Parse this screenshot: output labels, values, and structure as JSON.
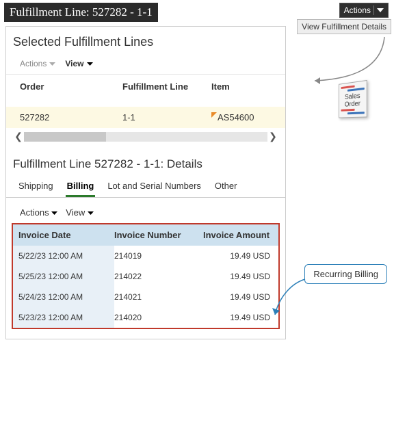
{
  "title": "Fulfillment Line: 527282 - 1-1",
  "actions_button": "Actions",
  "view_fulfillment_details": "View Fulfillment Details",
  "sales_order_label": "Sales Order",
  "recurring_billing_label": "Recurring Billing",
  "selected_panel": {
    "heading": "Selected Fulfillment Lines",
    "toolbar": {
      "actions": "Actions",
      "view": "View"
    },
    "columns": {
      "order": "Order",
      "fulfillment_line": "Fulfillment Line",
      "item": "Item"
    },
    "row": {
      "order": "527282",
      "fulfillment_line": "1-1",
      "item": "AS54600"
    }
  },
  "details": {
    "heading": "Fulfillment Line 527282 - 1-1: Details",
    "tabs": {
      "shipping": "Shipping",
      "billing": "Billing",
      "lot": "Lot and Serial Numbers",
      "other": "Other"
    },
    "toolbar": {
      "actions": "Actions",
      "view": "View"
    },
    "inv_columns": {
      "date": "Invoice Date",
      "number": "Invoice Number",
      "amount": "Invoice Amount"
    },
    "rows": [
      {
        "date": "5/22/23 12:00 AM",
        "number": "214019",
        "amount": "19.49 USD"
      },
      {
        "date": "5/25/23 12:00 AM",
        "number": "214022",
        "amount": "19.49 USD"
      },
      {
        "date": "5/24/23 12:00 AM",
        "number": "214021",
        "amount": "19.49 USD"
      },
      {
        "date": "5/23/23 12:00 AM",
        "number": "214020",
        "amount": "19.49 USD"
      }
    ]
  }
}
